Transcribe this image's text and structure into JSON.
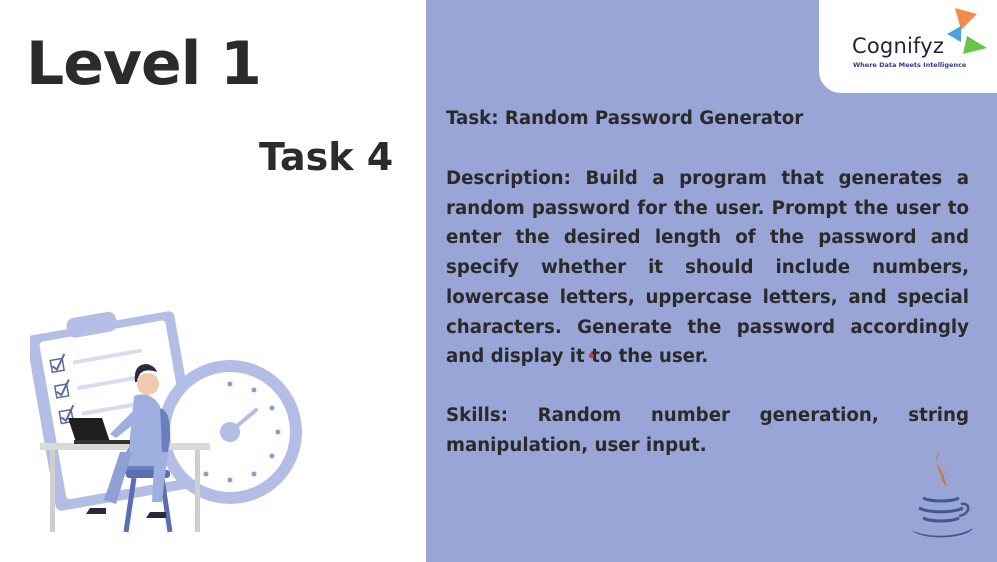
{
  "slide": {
    "level_title": "Level 1",
    "task_number": "Task 4"
  },
  "logo": {
    "name": "Cognifyz",
    "tagline": "Where Data Meets Intelligence",
    "mark_colors": [
      "#f28c4b",
      "#4aa3df",
      "#6cc24a"
    ]
  },
  "task": {
    "title": "Task: Random Password Generator",
    "description": "Description: Build a program that generates a random password for the user. Prompt the user to enter the desired length of the password and specify whether it should include numbers, lowercase letters, uppercase letters, and special characters. Generate the password accordingly and display it to the user.",
    "skills": "Skills: Random number generation, string manipulation, user input."
  },
  "colors": {
    "panel": "#98a5d6",
    "text": "#2a2a2a",
    "java_orange": "#e76f00",
    "java_blue": "#3e5a8f"
  },
  "icons": [
    "person-at-laptop-illustration",
    "clipboard-checklist-icon",
    "clock-icon",
    "java-logo-icon"
  ]
}
